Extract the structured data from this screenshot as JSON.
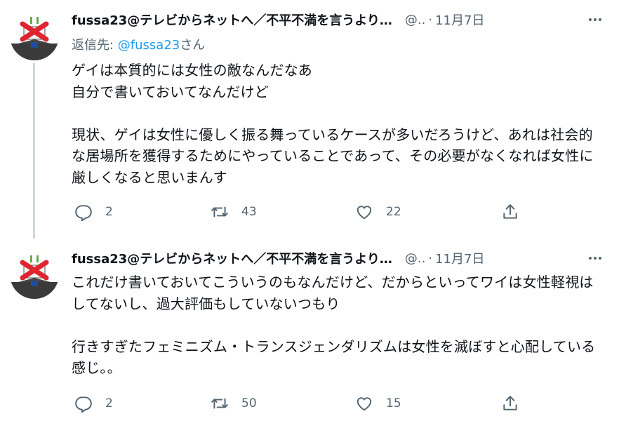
{
  "tweets": [
    {
      "name": "fussa23@テレビからネットへ／不平不満を言うより…",
      "handle": "@..",
      "date": "11月7日",
      "reply_prefix": "返信先: ",
      "reply_mention": "@fussa23",
      "reply_suffix": "さん",
      "text": "ゲイは本質的には女性の敵なんだなあ\n自分で書いておいてなんだけど\n\n現状、ゲイは女性に優しく振る舞っているケースが多いだろうけど、あれは社会的な居場所を獲得するためにやっていることであって、その必要がなくなれば女性に厳しくなると思いまんす",
      "replies": "2",
      "retweets": "43",
      "likes": "22"
    },
    {
      "name": "fussa23@テレビからネットへ／不平不満を言うより…",
      "handle": "@..",
      "date": "11月7日",
      "text": "これだけ書いておいてこういうのもなんだけど、だからといってワイは女性軽視はしてないし、過大評価もしていないつもり\n\n行きすぎたフェミニズム・トランスジェンダリズムは女性を滅ぼすと心配している感じ。。",
      "replies": "2",
      "retweets": "50",
      "likes": "15"
    }
  ],
  "icons": {
    "reply": "reply-icon",
    "retweet": "retweet-icon",
    "like": "heart-icon",
    "share": "share-icon",
    "more": "more-icon"
  },
  "colors": {
    "secondary_text": "#536471",
    "link": "#1d9bf0",
    "avatar_cross": "#e0242f"
  }
}
